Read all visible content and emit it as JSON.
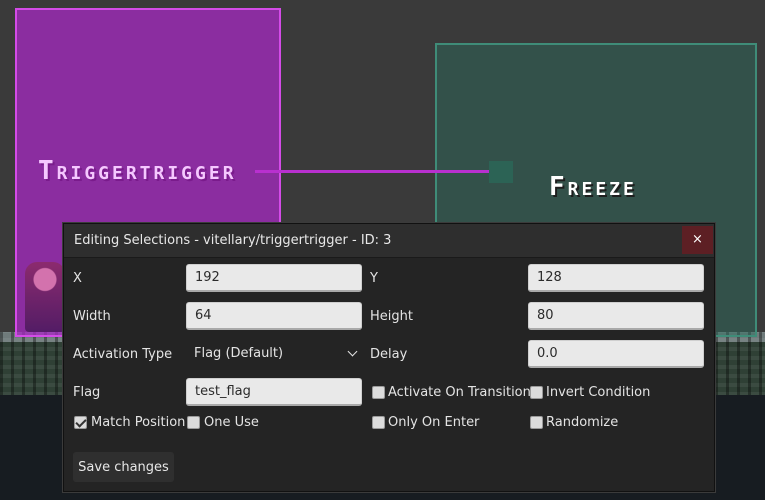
{
  "scene": {
    "trigger_a_label": "Triggertrigger",
    "trigger_b_label": "Freeze",
    "trigger_a_color": "#aa28c8",
    "trigger_b_color": "#2d6e5f"
  },
  "dialog": {
    "title": "Editing Selections - vitellary/triggertrigger - ID: 3",
    "close_label": "×",
    "fields": {
      "x": {
        "label": "X",
        "value": "192"
      },
      "y": {
        "label": "Y",
        "value": "128"
      },
      "width": {
        "label": "Width",
        "value": "64"
      },
      "height": {
        "label": "Height",
        "value": "80"
      },
      "activation_type": {
        "label": "Activation Type",
        "value": "Flag (Default)"
      },
      "delay": {
        "label": "Delay",
        "value": "0.0"
      },
      "flag": {
        "label": "Flag",
        "value": "test_flag"
      }
    },
    "checkboxes": {
      "activate_on_transition": {
        "label": "Activate On Transition",
        "checked": false
      },
      "invert_condition": {
        "label": "Invert Condition",
        "checked": false
      },
      "match_position": {
        "label": "Match Position",
        "checked": true
      },
      "one_use": {
        "label": "One Use",
        "checked": false
      },
      "only_on_enter": {
        "label": "Only On Enter",
        "checked": false
      },
      "randomize": {
        "label": "Randomize",
        "checked": false
      }
    },
    "save_label": "Save changes"
  }
}
